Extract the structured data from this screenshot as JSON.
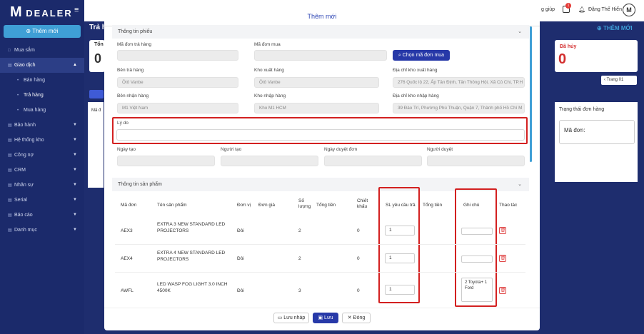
{
  "app": {
    "logo_letter": "M",
    "logo_text": "DEALER"
  },
  "sidebar": {
    "new_button": "Thêm mới",
    "items": [
      {
        "label": "Mua sắm",
        "icon": "□"
      },
      {
        "label": "Giao dịch",
        "icon": "▤"
      },
      {
        "label": "Bán hàng",
        "icon": "•"
      },
      {
        "label": "Trả hàng",
        "icon": "•"
      },
      {
        "label": "Mua hàng",
        "icon": "•"
      },
      {
        "label": "Bảo hành",
        "icon": "▤"
      },
      {
        "label": "Hệ thống kho",
        "icon": "▤"
      },
      {
        "label": "Công nợ",
        "icon": "▤"
      },
      {
        "label": "CRM",
        "icon": "▤"
      },
      {
        "label": "Nhân sự",
        "icon": "▤"
      },
      {
        "label": "Serial",
        "icon": "▤"
      },
      {
        "label": "Báo cáo",
        "icon": "▤"
      },
      {
        "label": "Danh mục",
        "icon": "▤"
      }
    ]
  },
  "topbar": {
    "help": "g giúp",
    "cart_count": "1",
    "user_name": "Đặng Thế Hiển",
    "avatar_letter": "M"
  },
  "page": {
    "title": "Trả hà",
    "card_left_label": "Tổn",
    "card_left_value": "0",
    "card_right_label": "Đã hủy",
    "card_right_value": "0",
    "add_new": "THÊM MỚI",
    "pagination": "Trang 01",
    "status_header": "Trạng thái đơn hàng",
    "order_code_label": "Mã đơn:",
    "left_col_label": "Mã đ"
  },
  "modal": {
    "title": "Thêm mới",
    "section_info": "Thông tin phiếu",
    "fields": {
      "return_code_label": "Mã đơn trả hàng",
      "purchase_code_label": "Mã đơn mua",
      "pick_order_button": "Chọn mã đơn mua",
      "returner_label": "Bên trả hàng",
      "returner_value": "Ôtô Vanbe",
      "out_wh_label": "Kho xuất hàng",
      "out_wh_value": "Ôtô Vanbe",
      "out_wh_addr_label": "Địa chỉ kho xuất hàng",
      "out_wh_addr_value": "276 Quốc lộ 22, Ấp Tân Định, Tân Thông Hội, Xã Củ Chi, TP.H",
      "receiver_label": "Bên nhận hàng",
      "receiver_value": "M1 Việt Nam",
      "in_wh_label": "Kho nhập hàng",
      "in_wh_value": "Kho M1 HCM",
      "in_wh_addr_label": "Địa chỉ kho nhập hàng",
      "in_wh_addr_value": "39 Đào Trí, Phường Phú Thuận, Quận 7, Thành phố Hồ Chí M",
      "reason_label": "Lý do",
      "created_date_label": "Ngày tạo",
      "creator_label": "Người tạo",
      "approve_date_label": "Ngày duyệt đơn",
      "approver_label": "Người duyệt"
    },
    "section_products": "Thông tin sản phẩm",
    "table": {
      "headers": [
        "Mã đơn",
        "Tên sản phẩm",
        "Đơn vị",
        "Đơn giá",
        "Số lượng",
        "Tổng tiền",
        "Chiết khấu",
        "SL yêu cầu trả",
        "Tổng tiền",
        "Ghi chú",
        "Thao tác"
      ],
      "rows": [
        {
          "code": "AEX3",
          "name": "EXTRA 3 NEW STANDARD LED PROJECTORS",
          "unit": "Đôi",
          "qty": "2",
          "discount": "0",
          "return_qty": "1",
          "note": ""
        },
        {
          "code": "AEX4",
          "name": "EXTRA 4 NEW STANDARD LED PROJECTORS",
          "unit": "Đôi",
          "qty": "2",
          "discount": "0",
          "return_qty": "1",
          "note": ""
        },
        {
          "code": "AWFL",
          "name": "LED WASP FOG LIGHT 3.0 INCH 4500K",
          "unit": "Đôi",
          "qty": "3",
          "discount": "0",
          "return_qty": "1",
          "note": "2 Toyota+ 1 Ford"
        }
      ]
    },
    "footer": {
      "draft": "Lưu nháp",
      "save": "Lưu",
      "close": "Đóng"
    }
  },
  "colors": {
    "sidebar": "#1b2a6b",
    "primary": "#2739a8",
    "accent": "#3f9fd6",
    "highlight": "#d32020"
  }
}
